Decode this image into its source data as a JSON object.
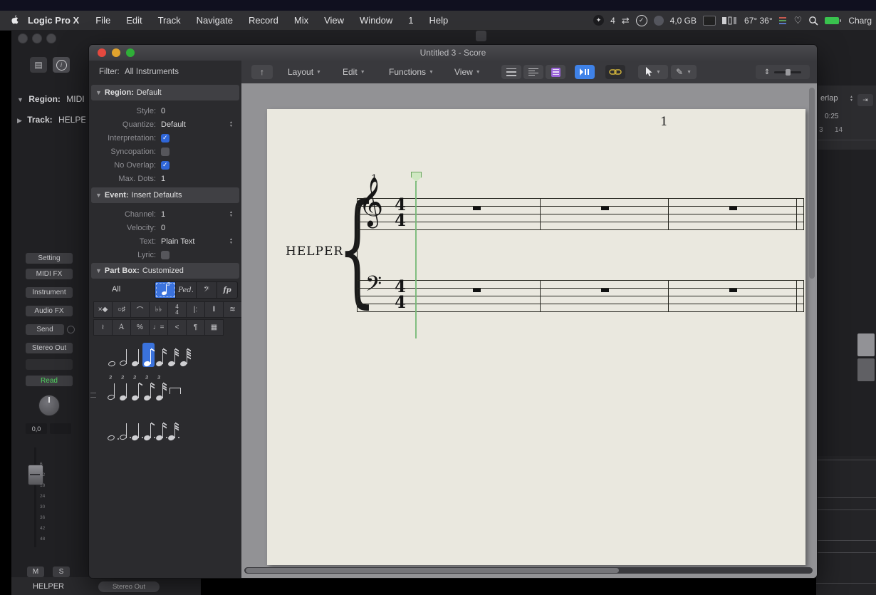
{
  "menu_bar": {
    "app_name": "Logic Pro X",
    "menus": [
      "File",
      "Edit",
      "Track",
      "Navigate",
      "Record",
      "Mix",
      "View",
      "Window",
      "1",
      "Help"
    ],
    "status": {
      "badge_count": "4",
      "memory": "4,0 GB",
      "temperature": "67° 36°",
      "battery_label": "Charg"
    }
  },
  "background_window": {
    "inspector": {
      "region_label": "Region:",
      "region_value": "MIDI",
      "track_label": "Track:",
      "track_value": "HELPE"
    },
    "channel_strip": {
      "setting": "Setting",
      "midi_fx": "MIDI FX",
      "instrument": "Instrument",
      "audio_fx": "Audio FX",
      "send": "Send",
      "stereo_out": "Stereo Out",
      "read": "Read",
      "pan_value": "0,0",
      "fader_ticks": [
        "6",
        "12",
        "18",
        "24",
        "30",
        "36",
        "42",
        "48"
      ],
      "mute": "M",
      "solo": "S",
      "track_name": "HELPER",
      "output_name": "Stereo Out"
    },
    "right_panel": {
      "overlap_text": "erlap",
      "time": "0:25",
      "bar_num_1": "3",
      "bar_num_2": "14"
    }
  },
  "score_window": {
    "title": "Untitled 3 - Score",
    "inspector": {
      "filter_label": "Filter:",
      "filter_value": "All Instruments",
      "region": {
        "title": "Region:",
        "value": "Default",
        "style_label": "Style:",
        "style_value": "0",
        "quantize_label": "Quantize:",
        "quantize_value": "Default",
        "interpretation_label": "Interpretation:",
        "syncopation_label": "Syncopation:",
        "no_overlap_label": "No Overlap:",
        "max_dots_label": "Max. Dots:",
        "max_dots_value": "1"
      },
      "event": {
        "title": "Event:",
        "value": "Insert Defaults",
        "channel_label": "Channel:",
        "channel_value": "1",
        "velocity_label": "Velocity:",
        "velocity_value": "0",
        "text_label": "Text:",
        "text_value": "Plain Text",
        "lyric_label": "Lyric:"
      },
      "part_box": {
        "title": "Part Box:",
        "value": "Customized",
        "all_tab": "All",
        "pedal_label": "Ped.",
        "dynamics_label": "fp"
      }
    },
    "toolbar": {
      "layout": "Layout",
      "edit": "Edit",
      "functions": "Functions",
      "view": "View"
    },
    "score": {
      "page_number": "1",
      "bar_number": "1",
      "instrument_name": "HELPER",
      "time_sig_numerator": "4",
      "time_sig_denominator": "4"
    }
  },
  "icons": {
    "treble_clef": "𝄞",
    "bass_clef": "𝄢",
    "brace": "{"
  },
  "colors": {
    "accent_blue": "#3a72dc",
    "link_yellow": "#d2b43c",
    "playhead_green": "#76b976",
    "read_green": "#4fd35f",
    "view_purple": "#9a63d8"
  }
}
